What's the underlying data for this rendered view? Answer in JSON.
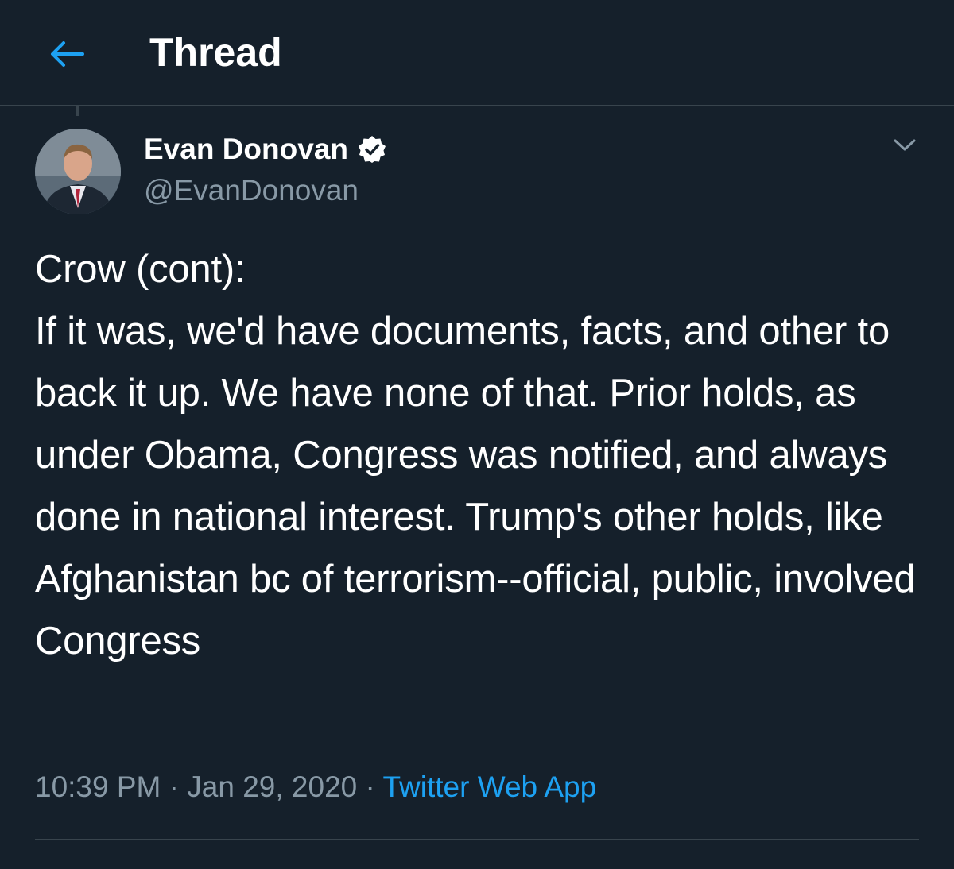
{
  "header": {
    "title": "Thread",
    "back_icon": "arrow-left-icon"
  },
  "colors": {
    "background": "#15202b",
    "accent": "#1da1f2",
    "muted_text": "#8899a6",
    "divider": "#38444d"
  },
  "tweet": {
    "author": {
      "display_name": "Evan Donovan",
      "handle": "@EvanDonovan",
      "verified": true,
      "verified_icon": "verified-badge-icon"
    },
    "menu_icon": "chevron-down-icon",
    "text": "Crow (cont):\nIf it was, we'd have documents, facts, and other to back it up. We have none of that. Prior holds, as under Obama, Congress was notified, and always done in national interest. Trump's other holds, like Afghanistan bc of terrorism--official, public, involved Congress",
    "time": "10:39 PM",
    "date": "Jan 29, 2020",
    "separator": "·",
    "source": "Twitter Web App"
  }
}
